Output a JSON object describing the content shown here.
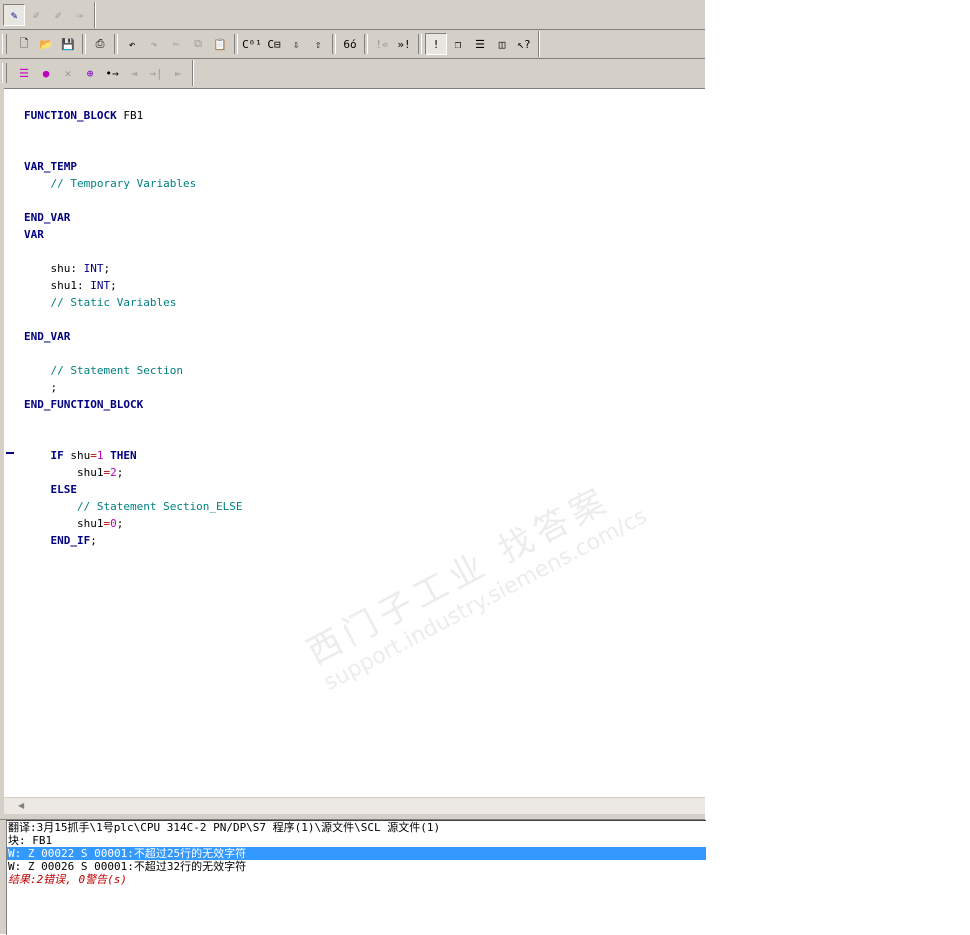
{
  "toolbar1": {
    "buttons": [
      {
        "icon": "compile-pen-icon",
        "glyph": "✎"
      },
      {
        "icon": "pen-arrow-icon",
        "glyph": "✐"
      },
      {
        "icon": "pen-arrow2-icon",
        "glyph": "✐"
      },
      {
        "icon": "pen-cross-icon",
        "glyph": "✑"
      }
    ]
  },
  "toolbar2": {
    "buttons": [
      {
        "icon": "new-file-icon",
        "glyph": "🗋"
      },
      {
        "icon": "open-folder-icon",
        "glyph": "📂"
      },
      {
        "icon": "save-icon",
        "glyph": "💾"
      },
      {
        "icon": "print-icon",
        "glyph": "⎙"
      },
      {
        "icon": "undo-icon",
        "glyph": "↶"
      },
      {
        "icon": "redo-icon",
        "glyph": "↷"
      },
      {
        "icon": "cut-icon",
        "glyph": "✂"
      },
      {
        "icon": "copy-icon",
        "glyph": "⧉"
      },
      {
        "icon": "paste-icon",
        "glyph": "📋"
      },
      {
        "icon": "compile-all-icon",
        "glyph": "C⁰¹"
      },
      {
        "icon": "compile-icon",
        "glyph": "C⊟"
      },
      {
        "icon": "download-icon",
        "glyph": "⇩"
      },
      {
        "icon": "upload-icon",
        "glyph": "⇧"
      },
      {
        "icon": "monitor-glasses-icon",
        "glyph": "6ό"
      },
      {
        "icon": "prev-error-icon",
        "glyph": "!«"
      },
      {
        "icon": "next-error-icon",
        "glyph": "»!"
      },
      {
        "icon": "error-toggle-icon",
        "glyph": "!"
      },
      {
        "icon": "cascade-windows-icon",
        "glyph": "❐"
      },
      {
        "icon": "tile-horizontal-icon",
        "glyph": "☰"
      },
      {
        "icon": "tile-vertical-icon",
        "glyph": "◫"
      },
      {
        "icon": "help-context-icon",
        "glyph": "↖?"
      }
    ]
  },
  "toolbar3": {
    "buttons": [
      {
        "icon": "list-icon",
        "glyph": "☰"
      },
      {
        "icon": "breakpoint-icon",
        "glyph": "●"
      },
      {
        "icon": "breakpoint-delete-icon",
        "glyph": "✕"
      },
      {
        "icon": "breakpoints-all-icon",
        "glyph": "⊕"
      },
      {
        "icon": "step-over-icon",
        "glyph": "•→"
      },
      {
        "icon": "step-into-icon",
        "glyph": "⇥"
      },
      {
        "icon": "step-out-icon",
        "glyph": "→|"
      },
      {
        "icon": "run-to-cursor-icon",
        "glyph": "⇤"
      }
    ]
  },
  "code_lines": [
    [
      {
        "t": "FUNCTION_BLOCK",
        "c": "kw"
      },
      {
        "t": " FB1",
        "c": "id"
      }
    ],
    [],
    [],
    [
      {
        "t": "VAR_TEMP",
        "c": "kw"
      }
    ],
    [
      {
        "t": "    // Temporary Variables",
        "c": "cm"
      }
    ],
    [],
    [
      {
        "t": "END_VAR",
        "c": "kw"
      }
    ],
    [
      {
        "t": "VAR",
        "c": "kw"
      }
    ],
    [],
    [
      {
        "t": "    shu",
        "c": "id"
      },
      {
        "t": ": ",
        "c": "id"
      },
      {
        "t": "INT",
        "c": "kw2"
      },
      {
        "t": ";",
        "c": "id"
      }
    ],
    [
      {
        "t": "    shu1",
        "c": "id"
      },
      {
        "t": ": ",
        "c": "id"
      },
      {
        "t": "INT",
        "c": "kw2"
      },
      {
        "t": ";",
        "c": "id"
      }
    ],
    [
      {
        "t": "    // Static Variables",
        "c": "cm"
      }
    ],
    [],
    [
      {
        "t": "END_VAR",
        "c": "kw"
      }
    ],
    [],
    [
      {
        "t": "    // Statement Section",
        "c": "cm"
      }
    ],
    [
      {
        "t": "    ;",
        "c": "id"
      }
    ],
    [
      {
        "t": "END_FUNCTION_BLOCK",
        "c": "kw"
      }
    ],
    [],
    [],
    [
      {
        "t": "    ",
        "c": "id"
      },
      {
        "t": "IF",
        "c": "kw"
      },
      {
        "t": " shu",
        "c": "id"
      },
      {
        "t": "=",
        "c": "op"
      },
      {
        "t": "1",
        "c": "num"
      },
      {
        "t": " ",
        "c": "id"
      },
      {
        "t": "THEN",
        "c": "kw"
      }
    ],
    [
      {
        "t": "        shu1",
        "c": "id"
      },
      {
        "t": "=",
        "c": "op"
      },
      {
        "t": "2",
        "c": "num"
      },
      {
        "t": ";",
        "c": "id"
      }
    ],
    [
      {
        "t": "    ",
        "c": "id"
      },
      {
        "t": "ELSE",
        "c": "kw"
      }
    ],
    [
      {
        "t": "        // Statement Section_ELSE",
        "c": "cm"
      }
    ],
    [
      {
        "t": "        shu1",
        "c": "id"
      },
      {
        "t": "=",
        "c": "op"
      },
      {
        "t": "0",
        "c": "num"
      },
      {
        "t": ";",
        "c": "id"
      }
    ],
    [
      {
        "t": "    ",
        "c": "id"
      },
      {
        "t": "END_IF",
        "c": "kw"
      },
      {
        "t": ";",
        "c": "id"
      }
    ]
  ],
  "output": {
    "lines": [
      {
        "text": "翻译:3月15抓手\\1号plc\\CPU 314C-2 PN/DP\\S7 程序(1)\\源文件\\SCL 源文件(1)",
        "kind": "normal"
      },
      {
        "text": "块: FB1",
        "kind": "normal"
      },
      {
        "text": "W: Z 00022 S 00001:不超过25行的无效字符",
        "kind": "selected"
      },
      {
        "text": "W: Z 00026 S 00001:不超过32行的无效字符",
        "kind": "normal"
      },
      {
        "text": "结果:2错误, 0警告(s)",
        "kind": "result"
      }
    ]
  },
  "watermark": {
    "line1": "西门子工业 找答案",
    "line2": "support.industry.siemens.com/cs"
  },
  "colors": {
    "keyword": "#000080",
    "comment": "#008080",
    "operator": "#c00000",
    "number": "#c000c0",
    "selection": "#3399ff"
  }
}
